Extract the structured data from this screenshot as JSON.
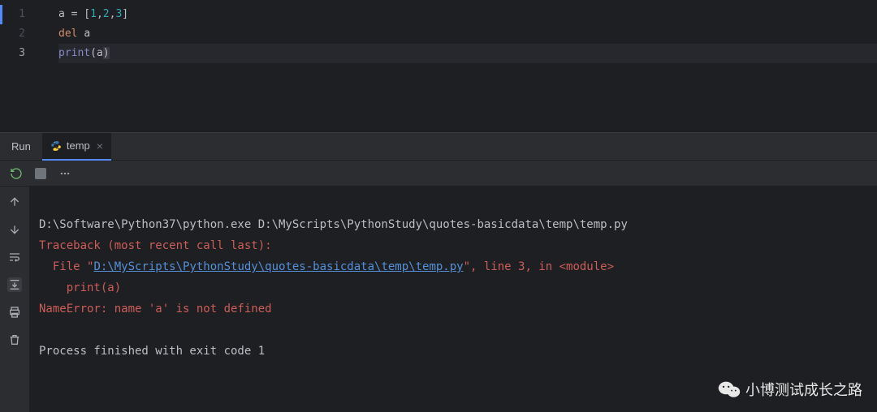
{
  "editor": {
    "lines": [
      {
        "n": "1",
        "active": false,
        "tokens": [
          {
            "t": "a ",
            "c": "ident"
          },
          {
            "t": "=",
            "c": "punct"
          },
          {
            "t": " [",
            "c": "punct"
          },
          {
            "t": "1",
            "c": "num"
          },
          {
            "t": ",",
            "c": "punct"
          },
          {
            "t": "2",
            "c": "num"
          },
          {
            "t": ",",
            "c": "punct"
          },
          {
            "t": "3",
            "c": "num"
          },
          {
            "t": "]",
            "c": "punct"
          }
        ]
      },
      {
        "n": "2",
        "active": false,
        "tokens": [
          {
            "t": "del ",
            "c": "kw"
          },
          {
            "t": "a",
            "c": "ident"
          }
        ]
      },
      {
        "n": "3",
        "active": true,
        "tokens": [
          {
            "t": "print",
            "c": "builtin"
          },
          {
            "t": "(a",
            "c": "ident"
          },
          {
            "t": ")",
            "c": "caret-box"
          }
        ]
      }
    ]
  },
  "run": {
    "panel_label": "Run",
    "tab_name": "temp"
  },
  "console": {
    "cmd": "D:\\Software\\Python37\\python.exe D:\\MyScripts\\PythonStudy\\quotes-basicdata\\temp\\temp.py",
    "trace_head": "Traceback (most recent call last):",
    "file_prefix": "  File \"",
    "file_link": "D:\\MyScripts\\PythonStudy\\quotes-basicdata\\temp\\temp.py",
    "file_suffix": "\", line 3, in <module>",
    "trace_line": "    print(a)",
    "name_error": "NameError: name 'a' is not defined",
    "blank": "",
    "finished": "Process finished with exit code 1"
  },
  "watermark": {
    "text": "小博测试成长之路"
  }
}
